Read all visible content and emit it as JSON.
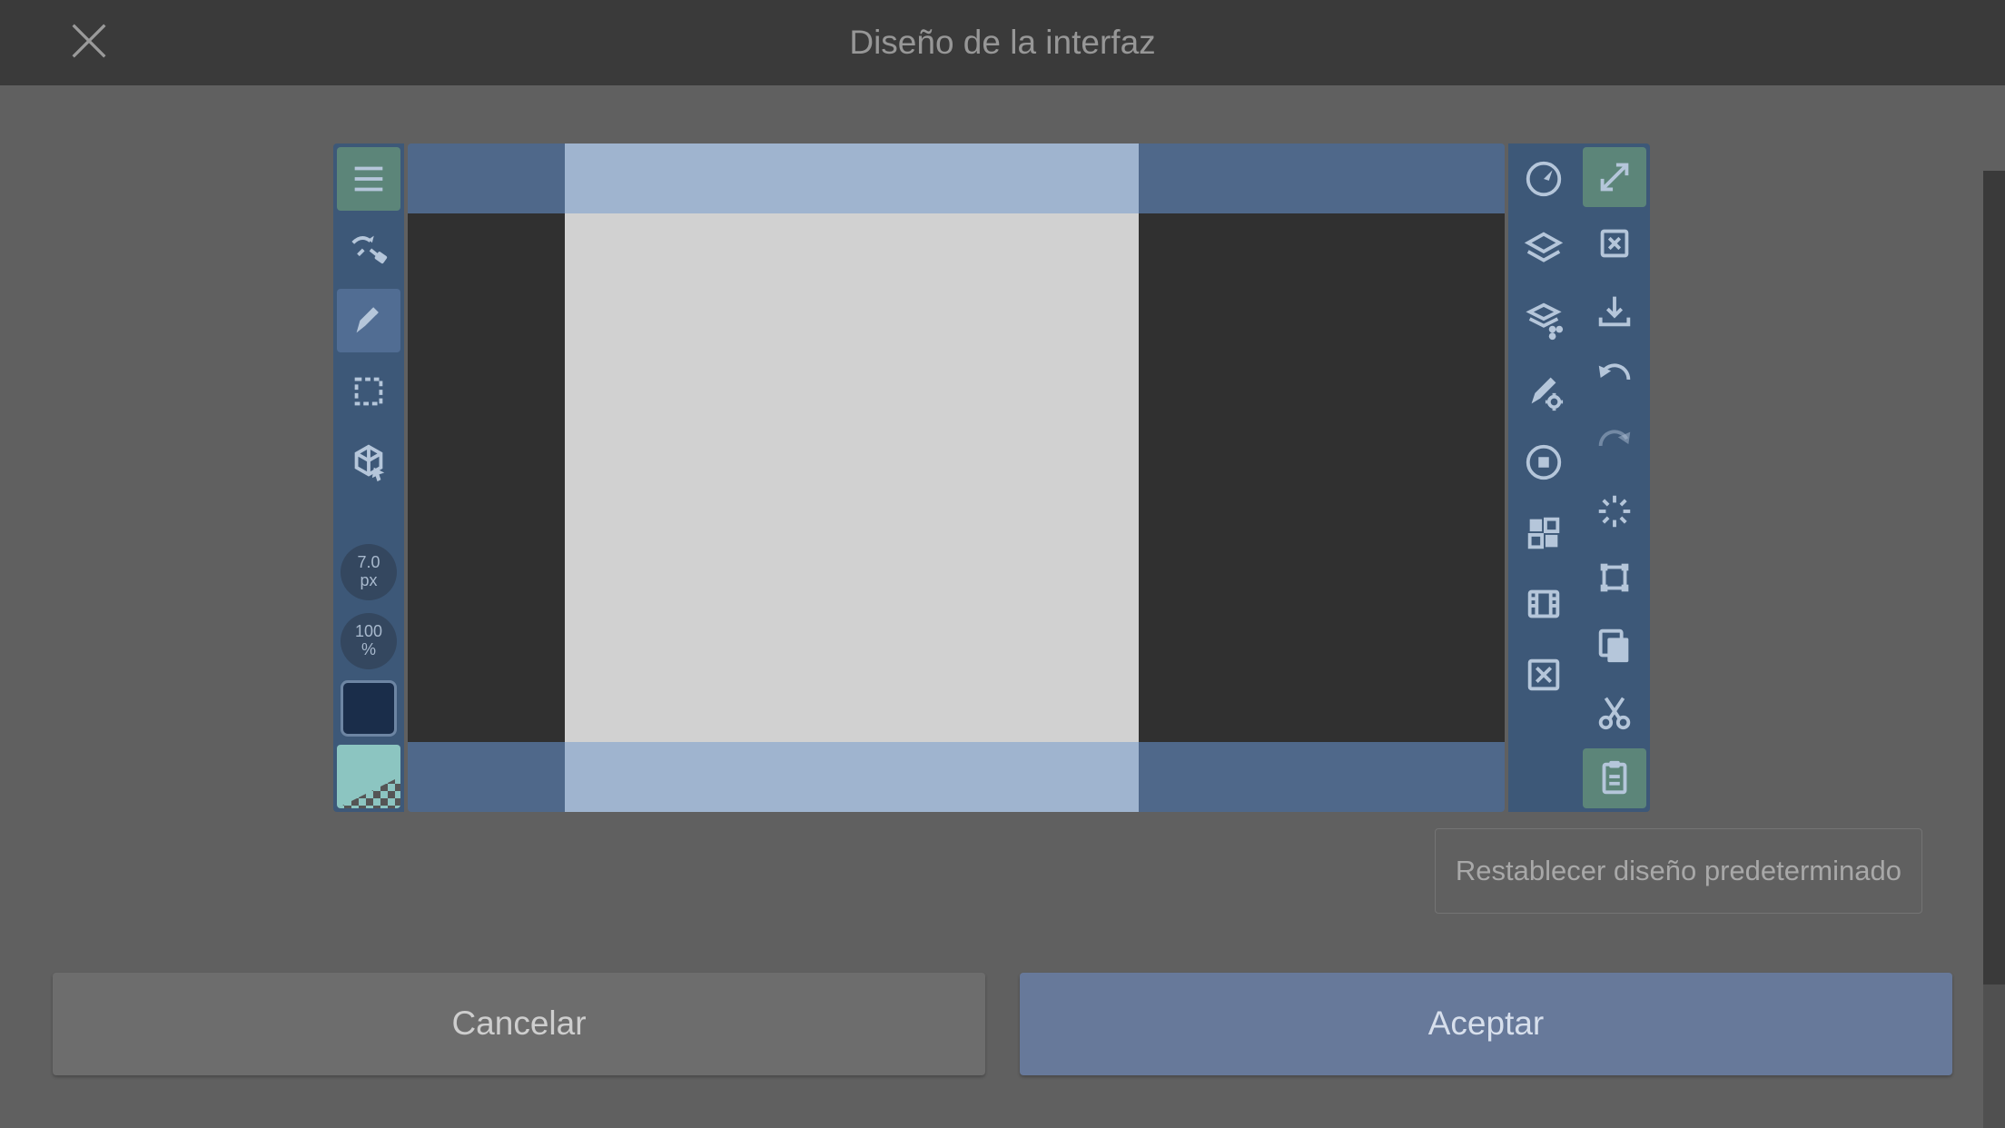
{
  "header": {
    "title": "Diseño de la interfaz"
  },
  "left_toolbar": {
    "brush_size_value": "7.0",
    "brush_size_unit": "px",
    "opacity_value": "100",
    "opacity_unit": "%"
  },
  "colors": {
    "primary": "#1a2d4a",
    "secondary": "#8cc5c1"
  },
  "buttons": {
    "reset": "Restablecer diseño predeterminado",
    "cancel": "Cancelar",
    "accept": "Aceptar"
  },
  "icon_names": {
    "menu": "menu-icon",
    "pen_eraser": "pen-eraser-icon",
    "pen": "pen-icon",
    "selection": "selection-icon",
    "cube_cursor": "cube-cursor-icon",
    "nav": "navigation-icon",
    "fullscreen": "fullscreen-icon",
    "layers": "layers-icon",
    "layers_add": "layers-add-icon",
    "brush_settings": "brush-settings-icon",
    "stop": "stop-icon",
    "grid": "grid-icon",
    "film": "film-icon",
    "clear": "clear-icon",
    "delete_layer": "delete-layer-icon",
    "import": "import-icon",
    "undo": "undo-icon",
    "redo": "redo-icon",
    "processing": "processing-icon",
    "transform": "transform-icon",
    "copy": "copy-icon",
    "cut": "cut-icon",
    "paste": "paste-icon"
  }
}
